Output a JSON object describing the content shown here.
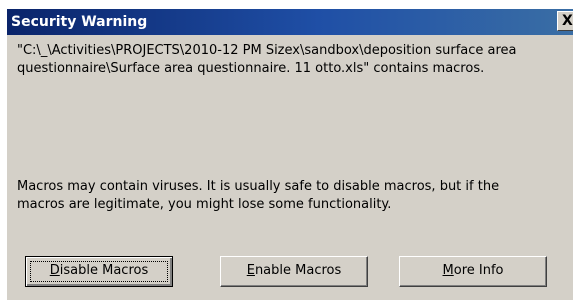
{
  "dialog": {
    "title": "Security Warning",
    "close_label": "X",
    "message_1": "\"C:\\_\\Activities\\PROJECTS\\2010-12 PM Sizex\\sandbox\\deposition surface area questionnaire\\Surface area questionnaire. 11 otto.xls\" contains macros.",
    "message_1_line1": "\"C:\\_\\Activities\\PROJECTS\\2010-12 PM Sizex\\sandbox\\deposition surface area",
    "message_1_line2": "questionnaire\\Surface area questionnaire. 11 otto.xls\" contains macros.",
    "message_2_line1": "Macros may contain viruses. It is usually safe to disable macros, but if the",
    "message_2_line2": "macros are legitimate, you might lose some functionality."
  },
  "buttons": {
    "disable": {
      "mnemonic": "D",
      "rest": "isable Macros"
    },
    "enable": {
      "mnemonic": "E",
      "rest": "nable Macros"
    },
    "more_info": {
      "mnemonic": "M",
      "rest": "ore Info"
    }
  },
  "colors": {
    "title_bar_start": "#0a246a",
    "title_bar_end": "#3a6ea5",
    "face": "#d4d0c8"
  }
}
